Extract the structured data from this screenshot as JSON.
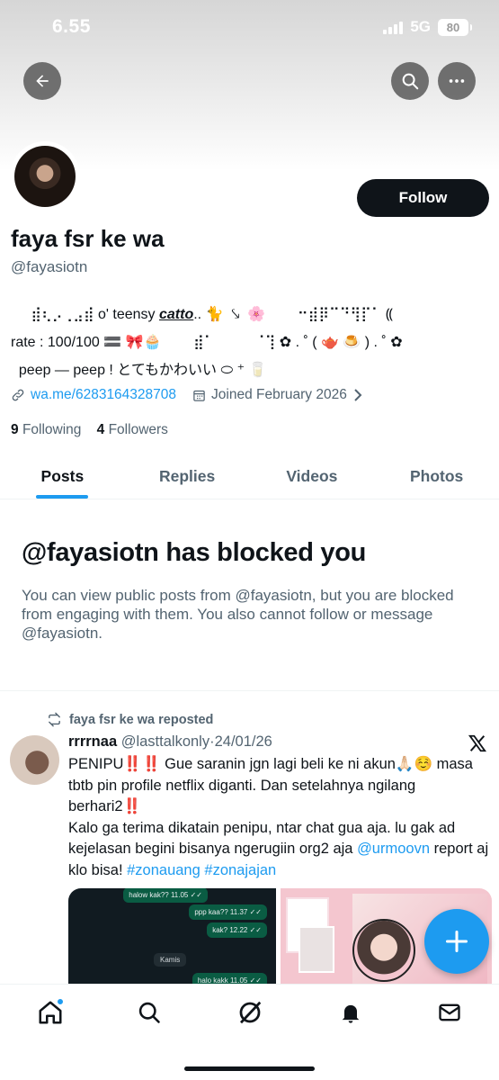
{
  "status": {
    "time": "6.55",
    "network": "5G",
    "battery": "80"
  },
  "header": {
    "back_icon": "arrow-left-icon",
    "search_icon": "search-icon",
    "more_icon": "more-horizontal-icon"
  },
  "profile": {
    "name": "faya fsr ke wa",
    "handle": "@fayasiotn",
    "follow_label": "Follow",
    "bio_line1_pre": "     ⣾⢆⡠⢀⣠⣾ o' teensy",
    "bio_line1_link": "catto",
    "bio_line1_post": ".. 🐈  ⤥  🌸        ⠒⣾⡿⠉⠙⢻⡏⠁ ⸨",
    "bio_line2": "rate : 100/100 🟰 🎀🧁        ⣾⠁          ⠈⢹ ✿ . ˚ ( 🫖 🍮 ) . ˚ ✿",
    "bio_line3": "  peep — peep ! とてもかわいい ⬭ ⁺ 🥛",
    "link": "wa.me/6283164328708",
    "joined": "Joined February 2026",
    "following_count": "9",
    "following_label": "Following",
    "followers_count": "4",
    "followers_label": "Followers"
  },
  "tabs": [
    {
      "label": "Posts",
      "active": true
    },
    {
      "label": "Replies",
      "active": false
    },
    {
      "label": "Videos",
      "active": false
    },
    {
      "label": "Photos",
      "active": false
    }
  ],
  "blocked": {
    "title": "@fayasiotn has blocked you",
    "message": "You can view public posts from @fayasiotn, but you are blocked from engaging with them. You also cannot follow or message @fayasiotn."
  },
  "post": {
    "repost_label": "faya fsr ke wa reposted",
    "author_name": "rrrrnaa",
    "author_handle": "@lasttalkonly",
    "separator": "·",
    "date": "24/01/26",
    "text_main": "PENIPU‼️‼️ Gue saranin jgn lagi beli ke ni akun🙏🏻☺️ masa tbtb pin profile netflix diganti. Dan setelahnya ngilang berhari2‼️\nKalo ga terima dikatain penipu, ntar chat gua aja. lu gak ad kejelasan begini bisanya ngerugiin org2 aja ",
    "mention": "@urmoovn",
    "text_mid": " report aj klo bisa! ",
    "hashtag1": "#zonauang",
    "hashtag2": "#zonajajan",
    "chat_bubbles": [
      "halow kak??  11.05 ✓✓",
      "ppp kaa??  11.37 ✓✓",
      "kak?  12.22 ✓✓",
      "halo kakk  11.05 ✓✓"
    ],
    "chat_day": "Kamis"
  },
  "nav": [
    "home-icon",
    "search-icon",
    "grok-icon",
    "notifications-icon",
    "messages-icon"
  ],
  "colors": {
    "accent": "#1d9bf0",
    "text": "#0f1419",
    "secondary": "#536471"
  }
}
